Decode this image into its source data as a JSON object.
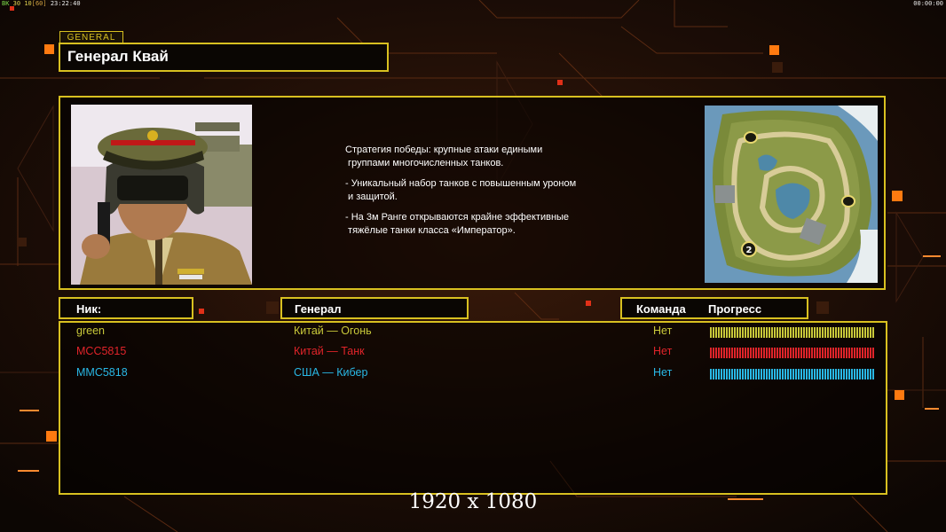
{
  "status_bar": {
    "left_items": [
      "ВК",
      "30",
      "10",
      "[60]",
      "23:22:40"
    ],
    "clock": "00:00:00"
  },
  "general": {
    "tag": "GENERAL",
    "name": "Генерал Квай",
    "strategy": [
      "Стратегия победы: крупные атаки едиными\n группами многочисленных танков.",
      "- Уникальный набор танков с повышенным уроном\n и защитой.",
      "- На 3м Ранге открываются крайне эффективные\n тяжёлые танки класса «Император»."
    ],
    "minimap_markers": [
      "2"
    ]
  },
  "columns": {
    "nick": "Ник:",
    "general": "Генерал",
    "team": "Команда",
    "progress": "Прогресс"
  },
  "players": [
    {
      "nick": "green",
      "general": "Китай — Огонь",
      "team": "Нет",
      "color": "#c9c93a",
      "progress": 1.0
    },
    {
      "nick": "MCC5815",
      "general": "Китай — Танк",
      "team": "Нет",
      "color": "#e0242a",
      "progress": 1.0
    },
    {
      "nick": "MMC5818",
      "general": "США — Кибер",
      "team": "Нет",
      "color": "#29b8e6",
      "progress": 1.0
    }
  ],
  "resolution_label": "1920 x 1080",
  "colors": {
    "accent": "#d8c020",
    "highlight": "#ff7a10",
    "background": "#120905"
  }
}
